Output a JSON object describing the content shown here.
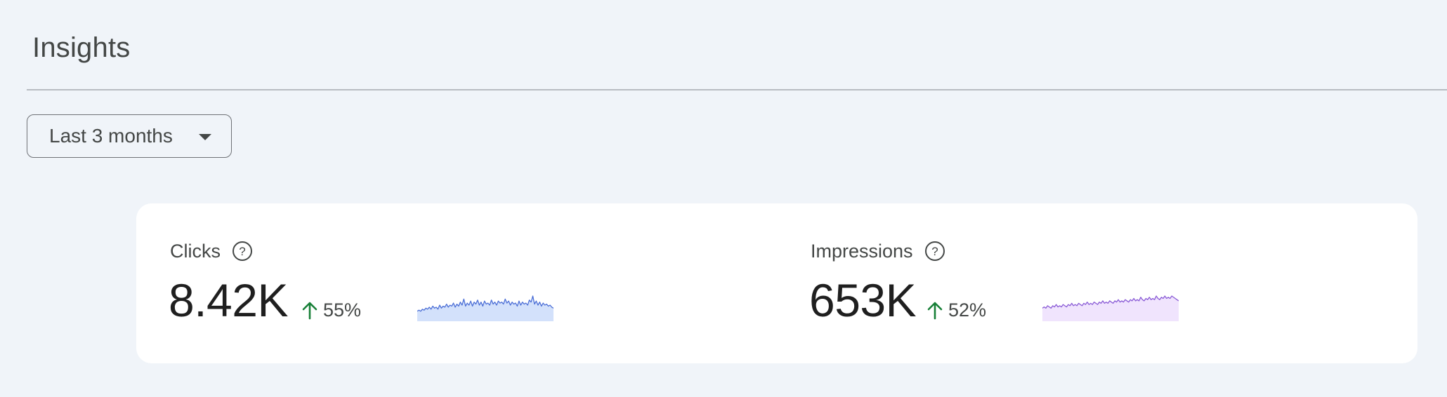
{
  "page": {
    "title": "Insights"
  },
  "filters": {
    "date_range": {
      "selected": "Last 3 months"
    }
  },
  "metrics": [
    {
      "label": "Clicks",
      "value": "8.42K",
      "change": "55%",
      "trend": "up",
      "help_icon": "help-circle-icon",
      "sparkline_color": "#4c6fd6",
      "sparkline_fill": "#d3e1fb",
      "sparkline_values": [
        3,
        4,
        3,
        5,
        4,
        6,
        5,
        7,
        5,
        8,
        6,
        7,
        5,
        9,
        6,
        8,
        7,
        10,
        7,
        9,
        8,
        11,
        7,
        10,
        8,
        12,
        9,
        15,
        8,
        11,
        9,
        13,
        8,
        12,
        10,
        14,
        9,
        12,
        8,
        13,
        10,
        11,
        9,
        14,
        10,
        12,
        9,
        13,
        11,
        12,
        10,
        15,
        11,
        13,
        9,
        12,
        10,
        11,
        8,
        13,
        9,
        12,
        10,
        11,
        9,
        14,
        12,
        18,
        10,
        13,
        9,
        12,
        8,
        11,
        9,
        10,
        8,
        9,
        7,
        6
      ]
    },
    {
      "label": "Impressions",
      "value": "653K",
      "change": "52%",
      "trend": "up",
      "help_icon": "help-circle-icon",
      "sparkline_color": "#8a5bd6",
      "sparkline_fill": "#f0e4fd",
      "sparkline_values": [
        5,
        6,
        5,
        7,
        6,
        5,
        7,
        6,
        8,
        6,
        7,
        6,
        8,
        7,
        6,
        8,
        7,
        9,
        7,
        8,
        7,
        9,
        8,
        7,
        9,
        8,
        10,
        8,
        9,
        8,
        10,
        9,
        8,
        10,
        9,
        11,
        9,
        10,
        9,
        11,
        10,
        9,
        11,
        10,
        12,
        10,
        11,
        10,
        12,
        11,
        10,
        12,
        11,
        13,
        11,
        12,
        11,
        14,
        12,
        11,
        13,
        12,
        14,
        12,
        13,
        12,
        15,
        13,
        12,
        14,
        13,
        15,
        13,
        14,
        13,
        15,
        14,
        13,
        12,
        11
      ]
    }
  ],
  "colors": {
    "background": "#f0f4f9",
    "card": "#ffffff",
    "trend_up": "#188038"
  }
}
